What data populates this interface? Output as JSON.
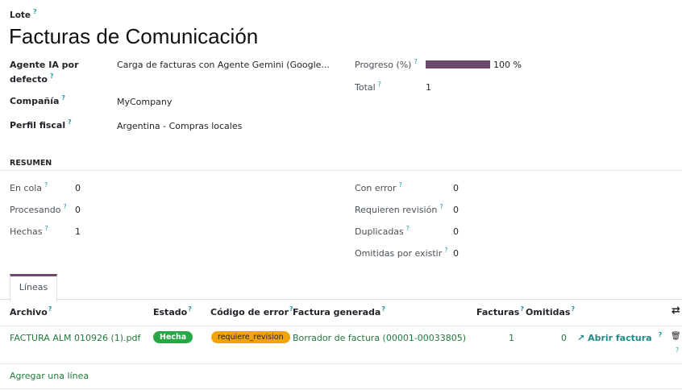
{
  "record": {
    "lote_label": "Lote",
    "title": "Facturas de Comunicación",
    "q": "?"
  },
  "fields": {
    "agente_label_1": "Agente IA por",
    "agente_label_2": "defecto",
    "agente_value": "Carga de facturas con Agente Gemini (Google...",
    "compania_label": "Compañía",
    "compania_value": "MyCompany",
    "perfil_label": "Perfil fiscal",
    "perfil_value": "Argentina - Compras locales",
    "progreso_label": "Progreso (%)",
    "progreso_value": "100 %",
    "progreso_fraction": 1.0,
    "total_label": "Total",
    "total_value": "1"
  },
  "resumen": {
    "title": "RESUMEN",
    "left": [
      {
        "label": "En cola",
        "value": "0"
      },
      {
        "label": "Procesando",
        "value": "0"
      },
      {
        "label": "Hechas",
        "value": "1"
      }
    ],
    "right": [
      {
        "label": "Con error",
        "value": "0"
      },
      {
        "label": "Requieren revisión",
        "value": "0"
      },
      {
        "label": "Duplicadas",
        "value": "0"
      },
      {
        "label": "Omitidas por existir",
        "value": "0"
      }
    ]
  },
  "tabs": [
    {
      "label": "Líneas"
    }
  ],
  "table": {
    "headers": {
      "archivo": "Archivo",
      "estado": "Estado",
      "codigo": "Código de error",
      "factura": "Factura generada",
      "facturas": "Facturas",
      "omitidas": "Omitidas"
    },
    "rows": [
      {
        "archivo": "FACTURA ALM 010926 (1).pdf",
        "estado": "Hecha",
        "codigo": "requiere_revision",
        "factura": "Borrador de factura (00001-00033805)",
        "facturas": "1",
        "omitidas": "0",
        "abrir": "Abrir factura"
      }
    ],
    "add_line": "Agregar una línea"
  },
  "icons": {
    "columns": "⇄",
    "trash": "🗑",
    "external": "↗"
  },
  "colors": {
    "accent_green": "#1f7a3a",
    "progress_fill": "#6c4a6c",
    "badge_done": "#28a745",
    "badge_warn": "#f0a30a",
    "tab_active": "#6c4a6c"
  }
}
